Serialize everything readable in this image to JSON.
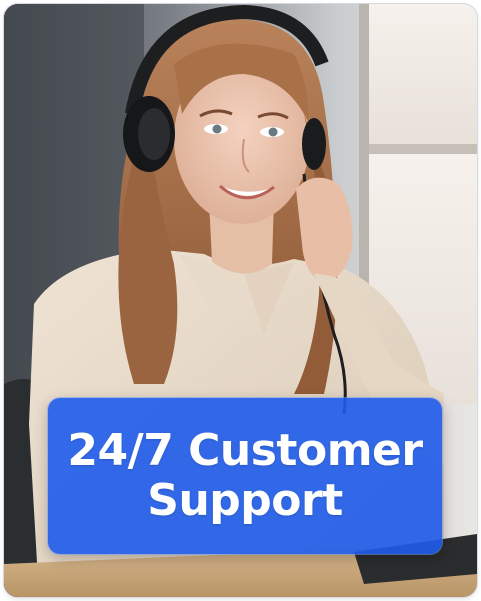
{
  "banner": {
    "line1": "24/7 Customer",
    "line2": "Support"
  },
  "colors": {
    "banner_blue": "#1e5ceb",
    "text": "#ffffff"
  },
  "image": {
    "subject": "customer-support-agent-photo"
  }
}
